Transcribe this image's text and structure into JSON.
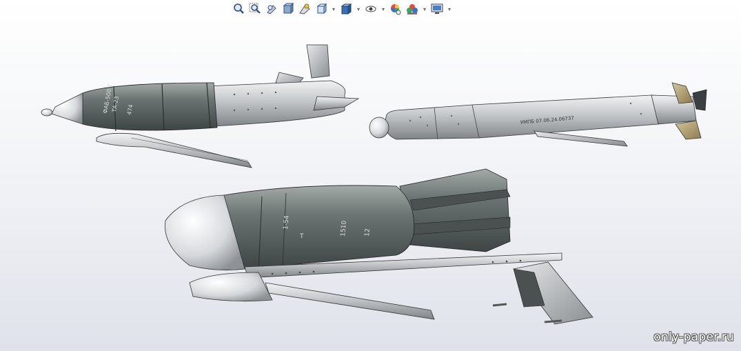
{
  "toolbar": {
    "items": [
      {
        "name": "zoom-to-fit-icon",
        "dropdown": false
      },
      {
        "name": "zoom-to-area-icon",
        "dropdown": false
      },
      {
        "name": "previous-view-icon",
        "dropdown": false
      },
      {
        "name": "section-view-icon",
        "dropdown": false
      },
      {
        "name": "dynamic-annotation-icon",
        "dropdown": false
      },
      {
        "name": "view-orientation-icon",
        "dropdown": true
      },
      {
        "name": "display-style-icon",
        "dropdown": true
      },
      {
        "name": "hide-show-items-icon",
        "dropdown": true
      },
      {
        "name": "edit-appearance-icon",
        "dropdown": false
      },
      {
        "name": "apply-scene-icon",
        "dropdown": true
      },
      {
        "name": "view-settings-icon",
        "dropdown": true
      }
    ]
  },
  "models": {
    "bomb_top_left": {
      "markings": [
        "ФАБ-500 Т",
        "ТА-23",
        "474"
      ],
      "color": "#5f6966"
    },
    "bomb_right": {
      "markings": [
        "УМПБ 07.06.24.06737"
      ],
      "color": "#c9cccf"
    },
    "bomb_bottom": {
      "markings": [
        "1-54",
        "Т",
        "1510",
        "12"
      ],
      "color": "#6b7472"
    }
  },
  "watermark": "only-paper.ru"
}
